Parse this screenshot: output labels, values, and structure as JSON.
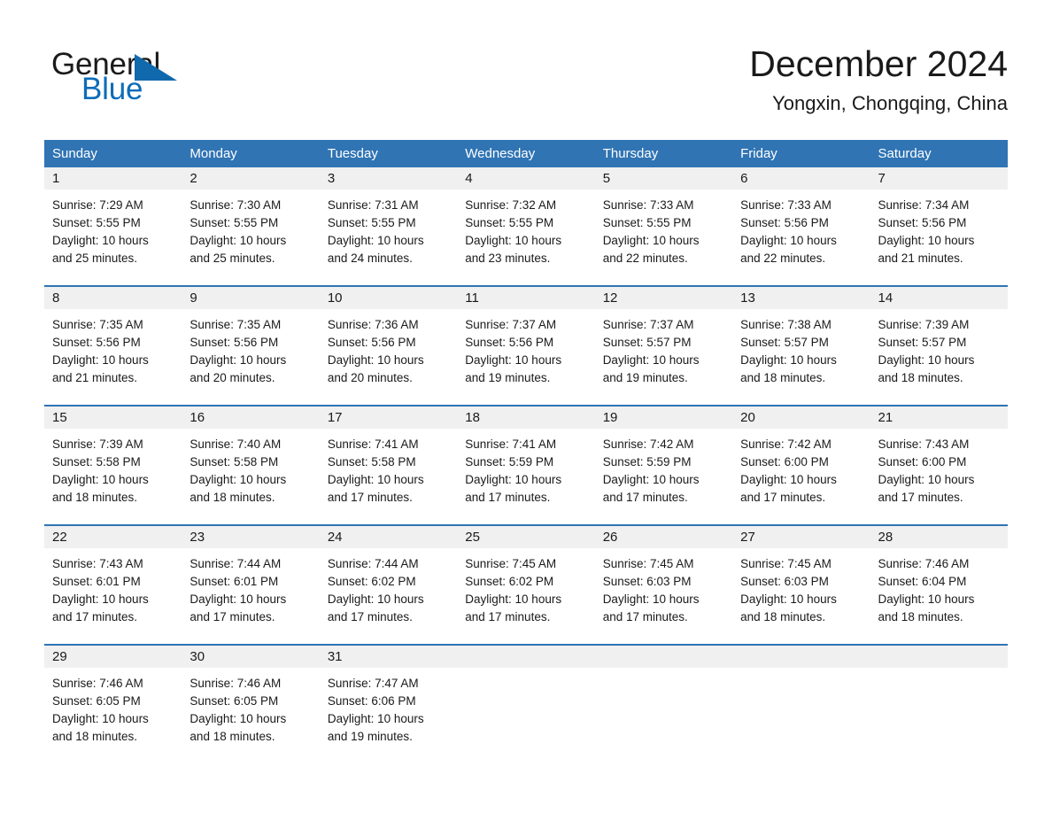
{
  "brand": {
    "name_part1": "General",
    "name_part2": "Blue",
    "triangle_color": "#1169ad",
    "text_color_dark": "#1a1a1a",
    "text_color_blue": "#0d6cb8"
  },
  "header": {
    "month_title": "December 2024",
    "location": "Yongxin, Chongqing, China",
    "accent_color": "#3074b4",
    "daynum_band_color": "#f0f0f0"
  },
  "weekday_headers": [
    "Sunday",
    "Monday",
    "Tuesday",
    "Wednesday",
    "Thursday",
    "Friday",
    "Saturday"
  ],
  "weeks": [
    {
      "numbers": [
        "1",
        "2",
        "3",
        "4",
        "5",
        "6",
        "7"
      ],
      "cells": [
        {
          "sunrise": "Sunrise: 7:29 AM",
          "sunset": "Sunset: 5:55 PM",
          "daylight1": "Daylight: 10 hours",
          "daylight2": "and 25 minutes."
        },
        {
          "sunrise": "Sunrise: 7:30 AM",
          "sunset": "Sunset: 5:55 PM",
          "daylight1": "Daylight: 10 hours",
          "daylight2": "and 25 minutes."
        },
        {
          "sunrise": "Sunrise: 7:31 AM",
          "sunset": "Sunset: 5:55 PM",
          "daylight1": "Daylight: 10 hours",
          "daylight2": "and 24 minutes."
        },
        {
          "sunrise": "Sunrise: 7:32 AM",
          "sunset": "Sunset: 5:55 PM",
          "daylight1": "Daylight: 10 hours",
          "daylight2": "and 23 minutes."
        },
        {
          "sunrise": "Sunrise: 7:33 AM",
          "sunset": "Sunset: 5:55 PM",
          "daylight1": "Daylight: 10 hours",
          "daylight2": "and 22 minutes."
        },
        {
          "sunrise": "Sunrise: 7:33 AM",
          "sunset": "Sunset: 5:56 PM",
          "daylight1": "Daylight: 10 hours",
          "daylight2": "and 22 minutes."
        },
        {
          "sunrise": "Sunrise: 7:34 AM",
          "sunset": "Sunset: 5:56 PM",
          "daylight1": "Daylight: 10 hours",
          "daylight2": "and 21 minutes."
        }
      ]
    },
    {
      "numbers": [
        "8",
        "9",
        "10",
        "11",
        "12",
        "13",
        "14"
      ],
      "cells": [
        {
          "sunrise": "Sunrise: 7:35 AM",
          "sunset": "Sunset: 5:56 PM",
          "daylight1": "Daylight: 10 hours",
          "daylight2": "and 21 minutes."
        },
        {
          "sunrise": "Sunrise: 7:35 AM",
          "sunset": "Sunset: 5:56 PM",
          "daylight1": "Daylight: 10 hours",
          "daylight2": "and 20 minutes."
        },
        {
          "sunrise": "Sunrise: 7:36 AM",
          "sunset": "Sunset: 5:56 PM",
          "daylight1": "Daylight: 10 hours",
          "daylight2": "and 20 minutes."
        },
        {
          "sunrise": "Sunrise: 7:37 AM",
          "sunset": "Sunset: 5:56 PM",
          "daylight1": "Daylight: 10 hours",
          "daylight2": "and 19 minutes."
        },
        {
          "sunrise": "Sunrise: 7:37 AM",
          "sunset": "Sunset: 5:57 PM",
          "daylight1": "Daylight: 10 hours",
          "daylight2": "and 19 minutes."
        },
        {
          "sunrise": "Sunrise: 7:38 AM",
          "sunset": "Sunset: 5:57 PM",
          "daylight1": "Daylight: 10 hours",
          "daylight2": "and 18 minutes."
        },
        {
          "sunrise": "Sunrise: 7:39 AM",
          "sunset": "Sunset: 5:57 PM",
          "daylight1": "Daylight: 10 hours",
          "daylight2": "and 18 minutes."
        }
      ]
    },
    {
      "numbers": [
        "15",
        "16",
        "17",
        "18",
        "19",
        "20",
        "21"
      ],
      "cells": [
        {
          "sunrise": "Sunrise: 7:39 AM",
          "sunset": "Sunset: 5:58 PM",
          "daylight1": "Daylight: 10 hours",
          "daylight2": "and 18 minutes."
        },
        {
          "sunrise": "Sunrise: 7:40 AM",
          "sunset": "Sunset: 5:58 PM",
          "daylight1": "Daylight: 10 hours",
          "daylight2": "and 18 minutes."
        },
        {
          "sunrise": "Sunrise: 7:41 AM",
          "sunset": "Sunset: 5:58 PM",
          "daylight1": "Daylight: 10 hours",
          "daylight2": "and 17 minutes."
        },
        {
          "sunrise": "Sunrise: 7:41 AM",
          "sunset": "Sunset: 5:59 PM",
          "daylight1": "Daylight: 10 hours",
          "daylight2": "and 17 minutes."
        },
        {
          "sunrise": "Sunrise: 7:42 AM",
          "sunset": "Sunset: 5:59 PM",
          "daylight1": "Daylight: 10 hours",
          "daylight2": "and 17 minutes."
        },
        {
          "sunrise": "Sunrise: 7:42 AM",
          "sunset": "Sunset: 6:00 PM",
          "daylight1": "Daylight: 10 hours",
          "daylight2": "and 17 minutes."
        },
        {
          "sunrise": "Sunrise: 7:43 AM",
          "sunset": "Sunset: 6:00 PM",
          "daylight1": "Daylight: 10 hours",
          "daylight2": "and 17 minutes."
        }
      ]
    },
    {
      "numbers": [
        "22",
        "23",
        "24",
        "25",
        "26",
        "27",
        "28"
      ],
      "cells": [
        {
          "sunrise": "Sunrise: 7:43 AM",
          "sunset": "Sunset: 6:01 PM",
          "daylight1": "Daylight: 10 hours",
          "daylight2": "and 17 minutes."
        },
        {
          "sunrise": "Sunrise: 7:44 AM",
          "sunset": "Sunset: 6:01 PM",
          "daylight1": "Daylight: 10 hours",
          "daylight2": "and 17 minutes."
        },
        {
          "sunrise": "Sunrise: 7:44 AM",
          "sunset": "Sunset: 6:02 PM",
          "daylight1": "Daylight: 10 hours",
          "daylight2": "and 17 minutes."
        },
        {
          "sunrise": "Sunrise: 7:45 AM",
          "sunset": "Sunset: 6:02 PM",
          "daylight1": "Daylight: 10 hours",
          "daylight2": "and 17 minutes."
        },
        {
          "sunrise": "Sunrise: 7:45 AM",
          "sunset": "Sunset: 6:03 PM",
          "daylight1": "Daylight: 10 hours",
          "daylight2": "and 17 minutes."
        },
        {
          "sunrise": "Sunrise: 7:45 AM",
          "sunset": "Sunset: 6:03 PM",
          "daylight1": "Daylight: 10 hours",
          "daylight2": "and 18 minutes."
        },
        {
          "sunrise": "Sunrise: 7:46 AM",
          "sunset": "Sunset: 6:04 PM",
          "daylight1": "Daylight: 10 hours",
          "daylight2": "and 18 minutes."
        }
      ]
    },
    {
      "numbers": [
        "29",
        "30",
        "31",
        "",
        "",
        "",
        ""
      ],
      "cells": [
        {
          "sunrise": "Sunrise: 7:46 AM",
          "sunset": "Sunset: 6:05 PM",
          "daylight1": "Daylight: 10 hours",
          "daylight2": "and 18 minutes."
        },
        {
          "sunrise": "Sunrise: 7:46 AM",
          "sunset": "Sunset: 6:05 PM",
          "daylight1": "Daylight: 10 hours",
          "daylight2": "and 18 minutes."
        },
        {
          "sunrise": "Sunrise: 7:47 AM",
          "sunset": "Sunset: 6:06 PM",
          "daylight1": "Daylight: 10 hours",
          "daylight2": "and 19 minutes."
        },
        {
          "sunrise": "",
          "sunset": "",
          "daylight1": "",
          "daylight2": ""
        },
        {
          "sunrise": "",
          "sunset": "",
          "daylight1": "",
          "daylight2": ""
        },
        {
          "sunrise": "",
          "sunset": "",
          "daylight1": "",
          "daylight2": ""
        },
        {
          "sunrise": "",
          "sunset": "",
          "daylight1": "",
          "daylight2": ""
        }
      ]
    }
  ]
}
